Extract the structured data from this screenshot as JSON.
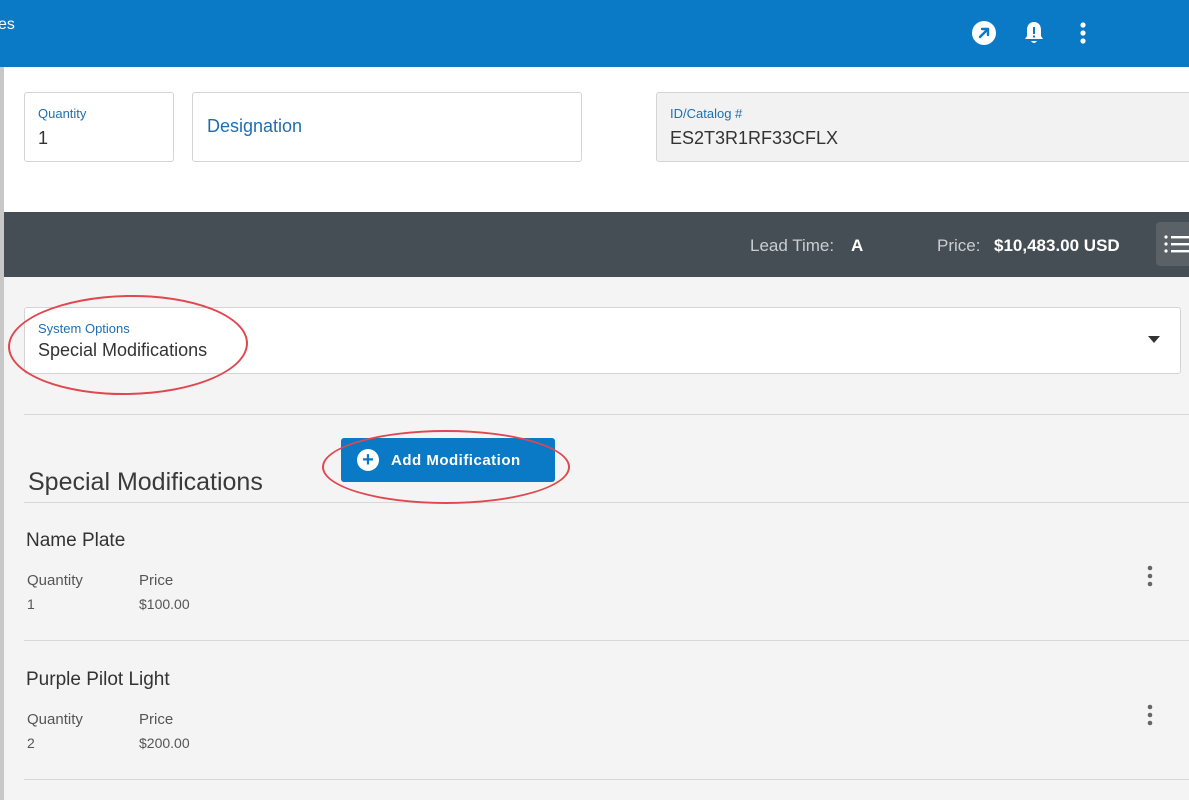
{
  "topbar": {
    "title": "es"
  },
  "form": {
    "quantity": {
      "label": "Quantity",
      "value": "1"
    },
    "designation": {
      "placeholder": "Designation"
    },
    "catalog": {
      "label": "ID/Catalog #",
      "value": "ES2T3R1RF33CFLX"
    }
  },
  "status": {
    "lead_time_label": "Lead Time:",
    "lead_time_value": "A",
    "price_label": "Price:",
    "price_value": "$10,483.00 USD"
  },
  "system_options": {
    "label": "System Options",
    "value": "Special Modifications"
  },
  "section": {
    "title": "Special Modifications",
    "add_button": "Add Modification"
  },
  "modifications": [
    {
      "name": "Name Plate",
      "quantity_label": "Quantity",
      "quantity": "1",
      "price_label": "Price",
      "price": "$100.00"
    },
    {
      "name": "Purple Pilot Light",
      "quantity_label": "Quantity",
      "quantity": "2",
      "price_label": "Price",
      "price": "$200.00"
    }
  ],
  "colors": {
    "primary": "#0a79c6",
    "status_bar": "#464e55",
    "annotation": "#e0474f"
  }
}
